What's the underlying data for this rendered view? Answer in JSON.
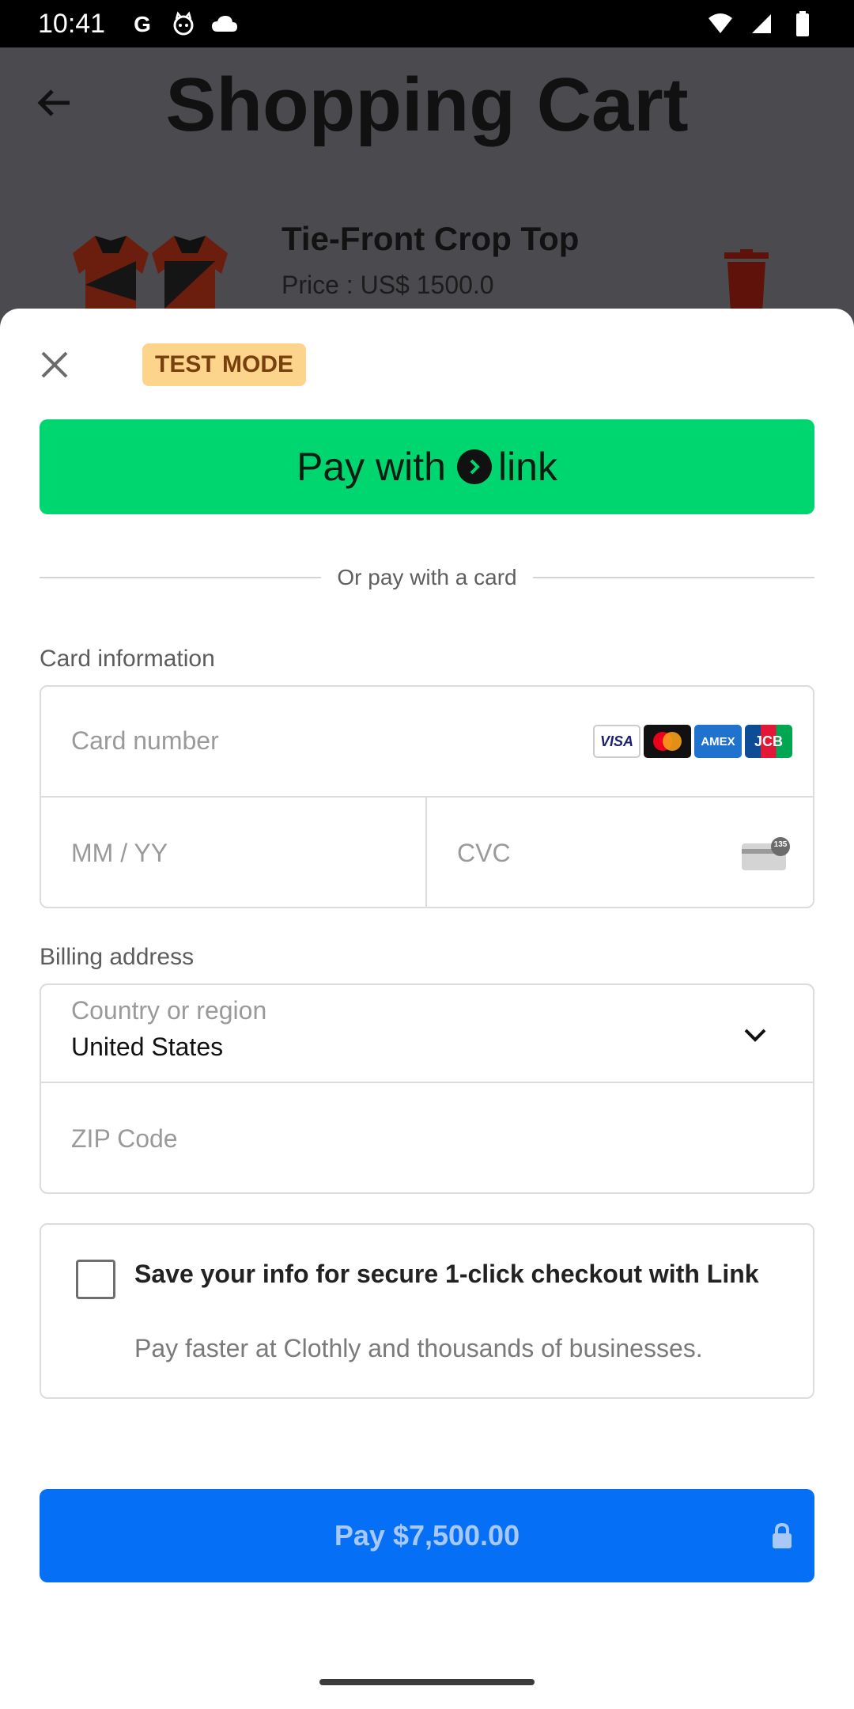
{
  "status_bar": {
    "time": "10:41",
    "left_icons": [
      "google-icon",
      "cat-icon",
      "cloud-icon"
    ],
    "right_icons": [
      "wifi-icon",
      "signal-icon",
      "battery-icon"
    ]
  },
  "background_app": {
    "title": "Shopping Cart",
    "item": {
      "name": "Tie-Front Crop Top",
      "price": "Price : US$ 1500.0"
    }
  },
  "sheet": {
    "test_mode": "TEST MODE",
    "link_button": {
      "prefix": "Pay with",
      "brand": "link"
    },
    "divider_text": "Or pay with a card",
    "card_section_label": "Card information",
    "card_number_placeholder": "Card number",
    "expiry_placeholder": "MM / YY",
    "cvc_placeholder": "CVC",
    "cvc_badge": "135",
    "card_brands": [
      "VISA",
      "mastercard",
      "AMEX",
      "JCB"
    ],
    "billing_section_label": "Billing address",
    "country_label": "Country or region",
    "country_value": "United States",
    "zip_placeholder": "ZIP Code",
    "save_title": "Save your info for secure 1-click checkout with Link",
    "save_subtitle": "Pay faster at Clothly and thousands of businesses.",
    "pay_button": "Pay $7,500.00"
  },
  "colors": {
    "link_green": "#00d66f",
    "pay_blue": "#0570f5",
    "test_badge": "#fcd48b"
  }
}
